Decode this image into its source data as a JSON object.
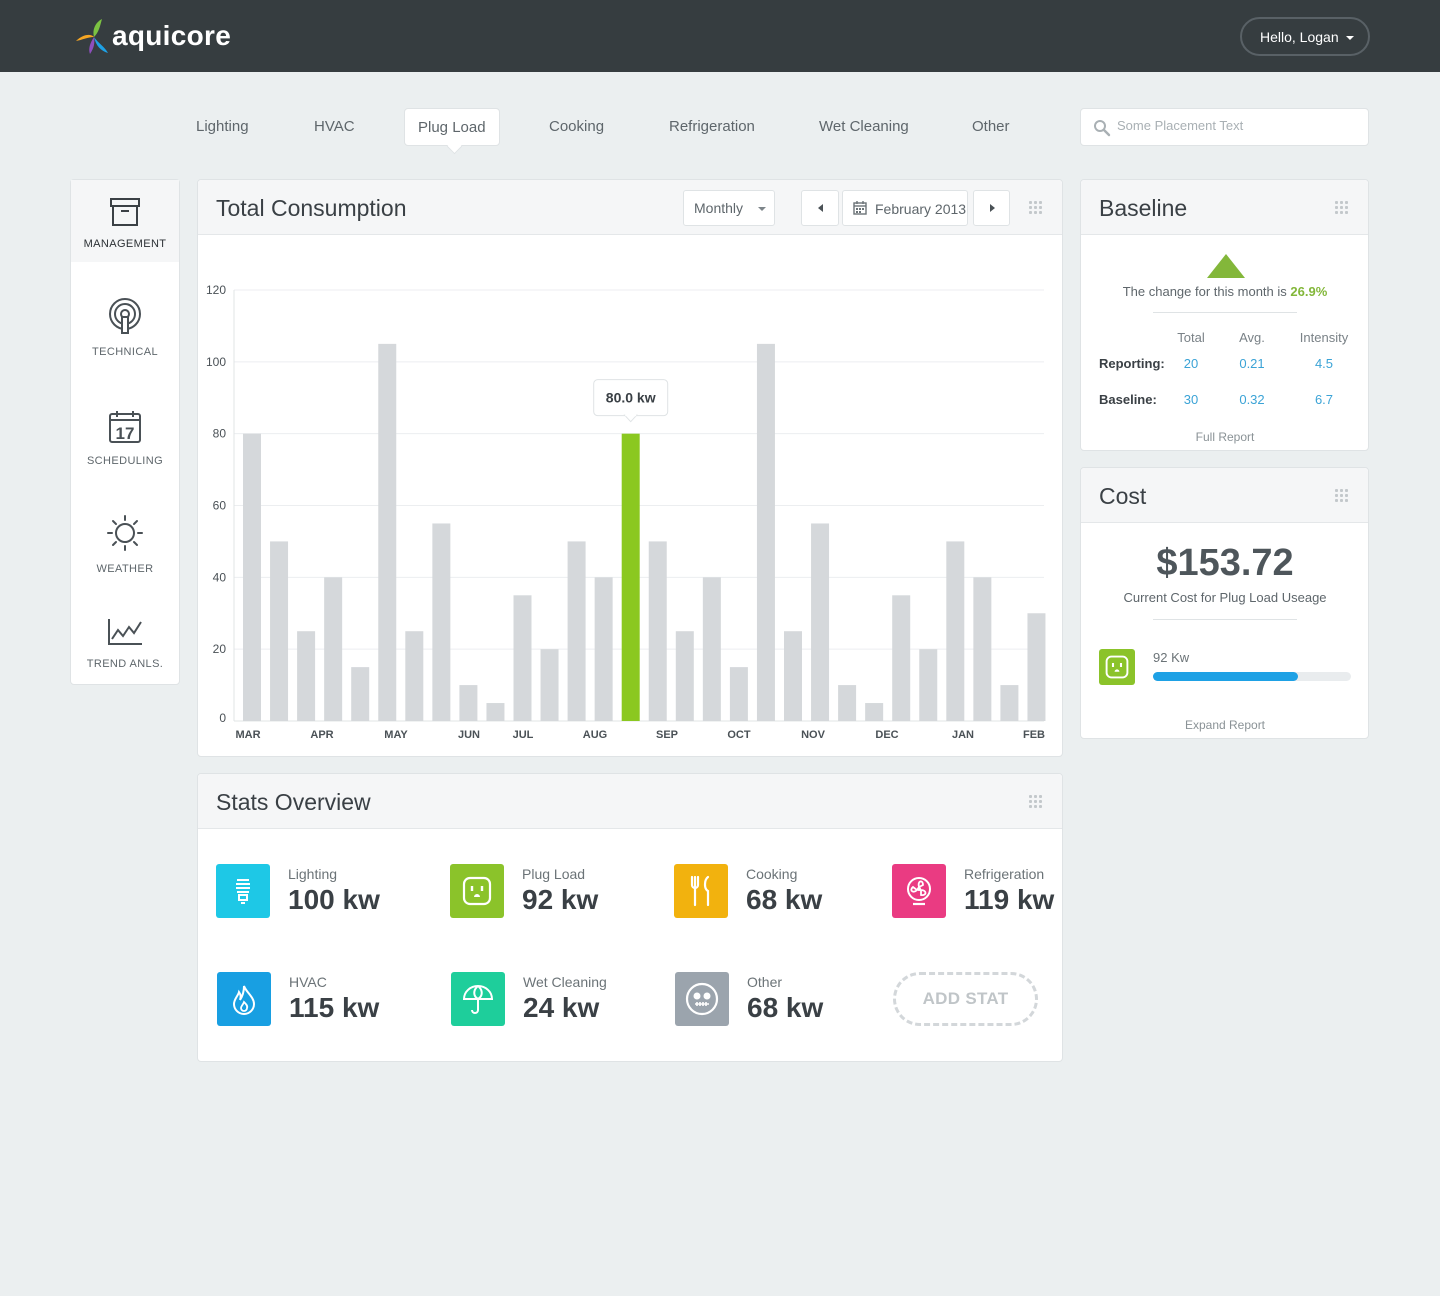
{
  "header": {
    "brand": "aquicore",
    "user_menu": "Hello, Logan"
  },
  "tabs": [
    {
      "label": "Lighting",
      "active": false
    },
    {
      "label": "HVAC",
      "active": false
    },
    {
      "label": "Plug Load",
      "active": true
    },
    {
      "label": "Cooking",
      "active": false
    },
    {
      "label": "Refrigeration",
      "active": false
    },
    {
      "label": "Wet Cleaning",
      "active": false
    },
    {
      "label": "Other",
      "active": false
    }
  ],
  "search": {
    "placeholder": "Some Placement Text",
    "value": ""
  },
  "sidebar": {
    "items": [
      {
        "label": "MANAGEMENT",
        "icon": "archive-box-icon",
        "active": true
      },
      {
        "label": "TECHNICAL",
        "icon": "broadcast-icon",
        "active": false
      },
      {
        "label": "SCHEDULING",
        "icon": "calendar-icon",
        "calendar_day": "17",
        "active": false
      },
      {
        "label": "WEATHER",
        "icon": "sun-icon",
        "active": false
      },
      {
        "label": "TREND ANLS.",
        "icon": "trend-chart-icon",
        "active": false
      }
    ]
  },
  "consumption": {
    "title": "Total Consumption",
    "period_select": "Monthly",
    "date_label": "February 2013"
  },
  "chart_data": {
    "type": "bar",
    "title": "Total Consumption",
    "xlabel": "",
    "ylabel": "",
    "ylim": [
      0,
      120
    ],
    "yticks": [
      0,
      20,
      40,
      60,
      80,
      100,
      120
    ],
    "grid": true,
    "x_tick_labels": [
      "MAR",
      "APR",
      "MAY",
      "JUN",
      "JUL",
      "AUG",
      "SEP",
      "OCT",
      "NOV",
      "DEC",
      "JAN",
      "FEB"
    ],
    "values": [
      80,
      50,
      25,
      40,
      15,
      105,
      25,
      55,
      10,
      5,
      35,
      20,
      50,
      40,
      80,
      50,
      25,
      40,
      15,
      105,
      25,
      55,
      10,
      5,
      35,
      20,
      50,
      40,
      10,
      30
    ],
    "highlight_index": 14,
    "highlight_color": "#8bc820",
    "bar_color": "#d5d8db",
    "tooltip": "80.0 kw"
  },
  "stats": {
    "title": "Stats Overview",
    "items": [
      {
        "label": "Lighting",
        "value": "100 kw",
        "color": "#1ec8e6",
        "icon": "lightbulb-icon"
      },
      {
        "label": "Plug Load",
        "value": "92 kw",
        "color": "#8bc32a",
        "icon": "outlet-icon"
      },
      {
        "label": "Cooking",
        "value": "68 kw",
        "color": "#f2b20e",
        "icon": "fork-knife-icon"
      },
      {
        "label": "Refrigeration",
        "value": "119 kw",
        "color": "#ea3b82",
        "icon": "fan-icon"
      },
      {
        "label": "HVAC",
        "value": "115 kw",
        "color": "#189fe2",
        "icon": "flame-icon"
      },
      {
        "label": "Wet Cleaning",
        "value": "24 kw",
        "color": "#1ece9b",
        "icon": "umbrella-icon"
      },
      {
        "label": "Other",
        "value": "68 kw",
        "color": "#9ba4ad",
        "icon": "skull-icon"
      }
    ],
    "add_label": "ADD STAT"
  },
  "baseline": {
    "title": "Baseline",
    "change_text": "The change for this month is",
    "change_value": "26.9%",
    "headers": [
      "Total",
      "Avg.",
      "Intensity"
    ],
    "rows": [
      {
        "label": "Reporting:",
        "values": [
          "20",
          "0.21",
          "4.5"
        ]
      },
      {
        "label": "Baseline:",
        "values": [
          "30",
          "0.32",
          "6.7"
        ]
      }
    ],
    "link": "Full Report"
  },
  "cost": {
    "title": "Cost",
    "amount": "$153.72",
    "subtitle": "Current Cost for Plug Load Useage",
    "kw_label": "92 Kw",
    "progress": 0.73,
    "link": "Expand Report"
  }
}
